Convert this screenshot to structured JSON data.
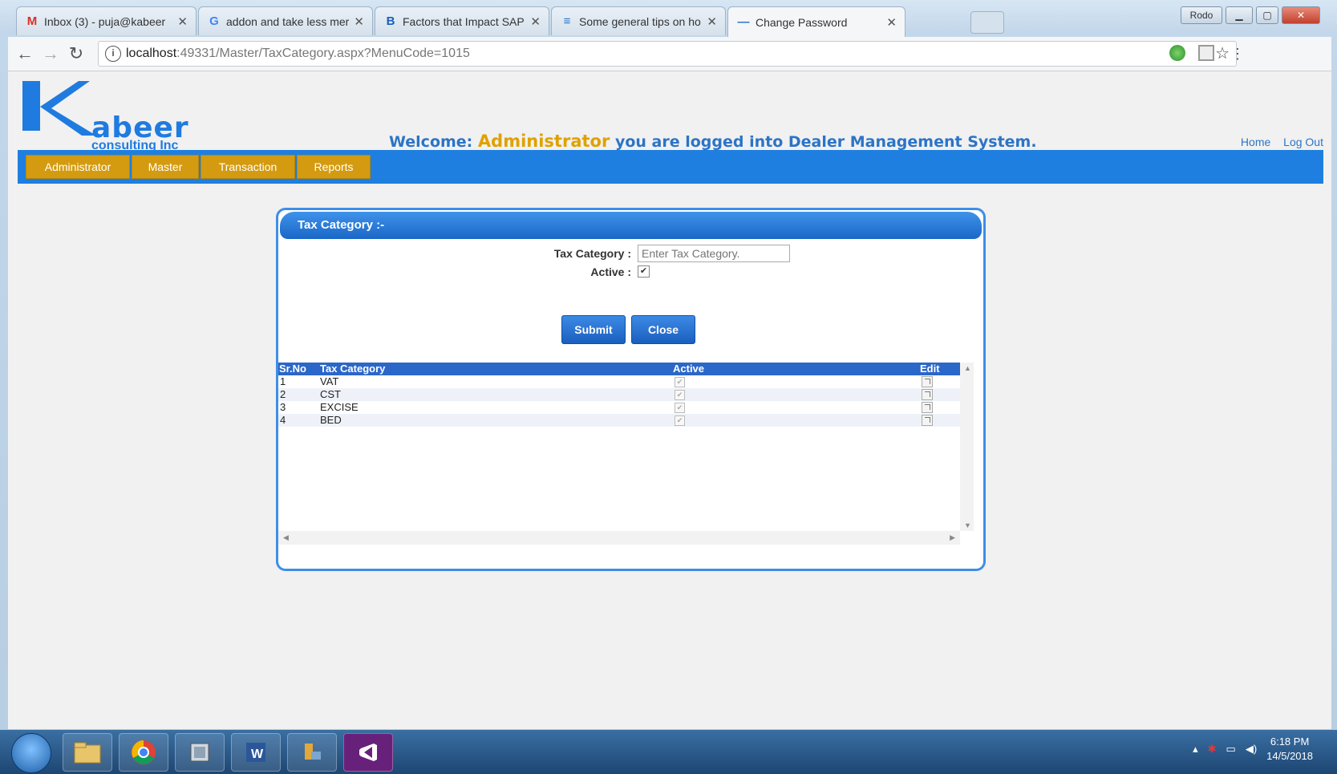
{
  "browser": {
    "tabs": [
      {
        "title": "Inbox (3) - puja@kabeer",
        "icon": "gmail-icon",
        "icon_char": "M",
        "icon_color": "#d93025"
      },
      {
        "title": "addon and take less mer",
        "icon": "google-icon",
        "icon_char": "G",
        "icon_color": "#4285f4"
      },
      {
        "title": "Factors that Impact SAP",
        "icon": "blog-icon",
        "icon_char": "B",
        "icon_color": "#1b5fb5"
      },
      {
        "title": "Some general tips on ho",
        "icon": "doc-icon",
        "icon_char": "≡",
        "icon_color": "#2b74c7"
      },
      {
        "title": "Change Password",
        "icon": "page-icon",
        "icon_char": "—",
        "icon_color": "#2b74c7"
      }
    ],
    "window_user": "Rodo",
    "url_host": "localhost",
    "url_path": ":49331/Master/TaxCategory.aspx?MenuCode=1015"
  },
  "header": {
    "logo_mark": "K",
    "logo_word": "abeer",
    "logo_sub": "consulting Inc",
    "welcome_prefix": "Welcome:",
    "welcome_user": "Administrator",
    "welcome_suffix": "you are logged into Dealer Management System.",
    "home_link": "Home",
    "logout_link": "Log Out"
  },
  "menu": [
    {
      "label": "Administrator"
    },
    {
      "label": "Master"
    },
    {
      "label": "Transaction"
    },
    {
      "label": "Reports"
    }
  ],
  "form": {
    "title": "Tax Category :-",
    "tax_label": "Tax Category :",
    "tax_placeholder": "Enter Tax Category.",
    "active_label": "Active :",
    "active_checked": true,
    "submit_label": "Submit",
    "close_label": "Close"
  },
  "grid": {
    "columns": [
      "Sr.No",
      "Tax Category",
      "Active",
      "Edit"
    ],
    "rows": [
      {
        "srno": "1",
        "category": "VAT",
        "active": true
      },
      {
        "srno": "2",
        "category": "CST",
        "active": true
      },
      {
        "srno": "3",
        "category": "EXCISE",
        "active": true
      },
      {
        "srno": "4",
        "category": "BED",
        "active": true
      }
    ]
  },
  "taskbar": {
    "time": "6:18 PM",
    "date": "14/5/2018"
  },
  "colors": {
    "accent_blue": "#1e7fe0",
    "menu_gold": "#d49b10",
    "welcome_user": "#e0a100"
  }
}
